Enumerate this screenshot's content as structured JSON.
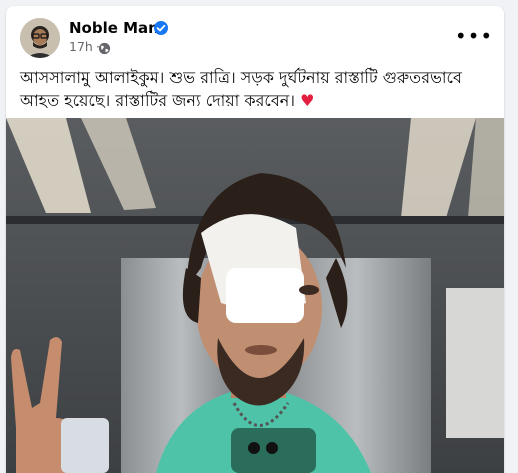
{
  "post": {
    "author": "Noble Man",
    "timestamp": "17h",
    "separator": "·",
    "caption": "আসসালামু আলাইকুম। শুভ রাত্রি। সড়ক দুর্ঘটনায় রাস্তাটি গুরুতরভাবে আহত হয়েছে। রাস্তাটির জন্য দোয়া করবেন।",
    "caption_emoji": "♥",
    "more_label": "•••"
  },
  "icons": {
    "verified": "verified-badge-icon",
    "audience": "globe-icon",
    "more": "more-options-icon",
    "reaction": "heart-emoji-icon"
  },
  "colors": {
    "brand": "#1877f2",
    "text": "#050505",
    "secondary_text": "#65676b",
    "heart": "#e41e3f",
    "background": "#f0f2f5"
  }
}
